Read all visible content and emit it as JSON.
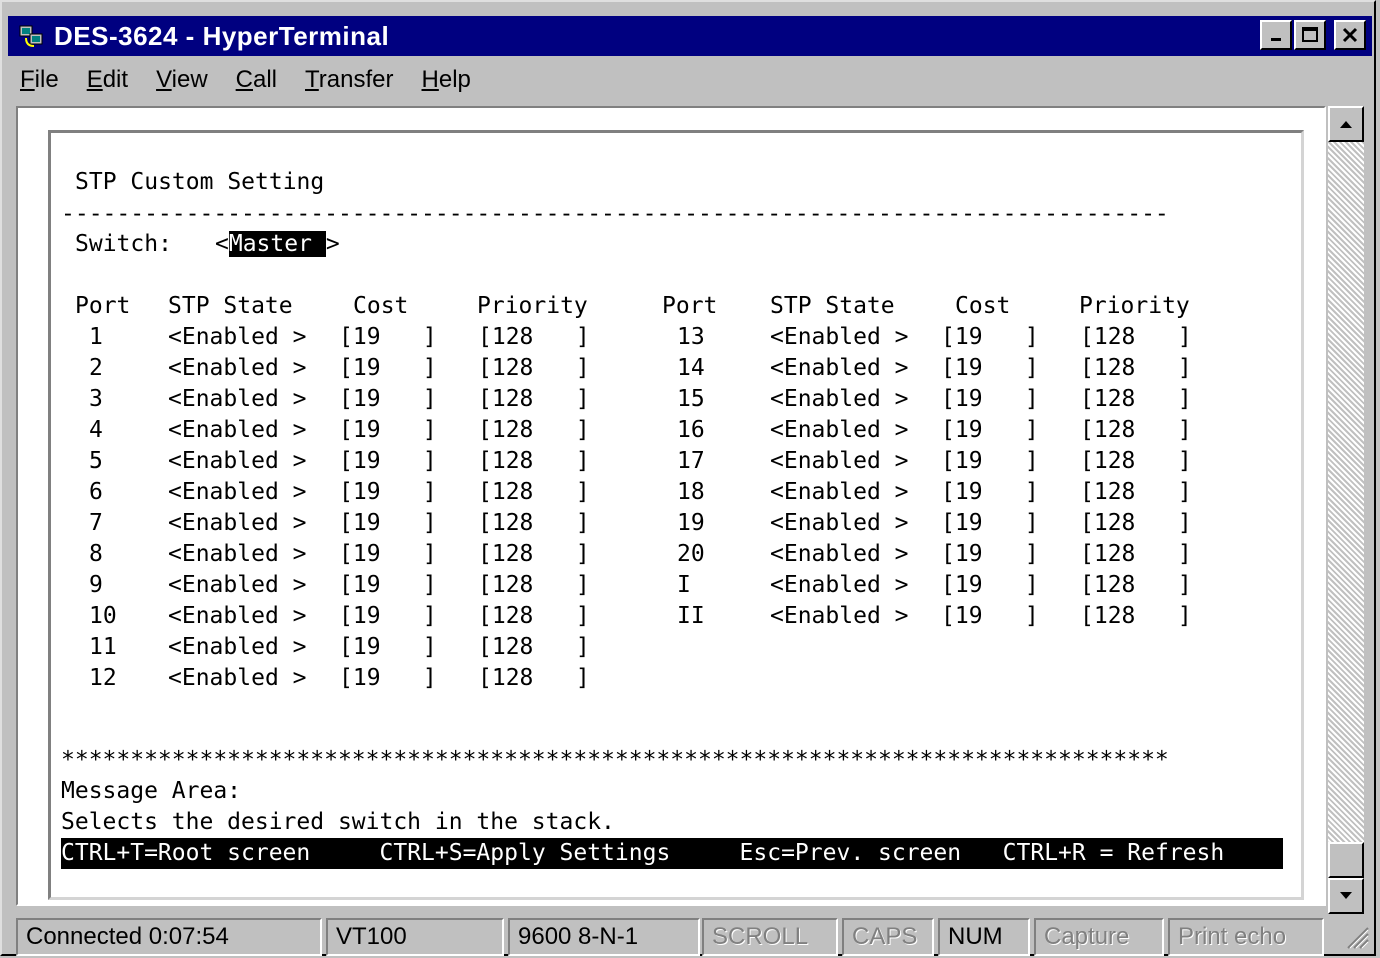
{
  "window": {
    "title": "DES-3624 - HyperTerminal"
  },
  "menu": [
    "File",
    "Edit",
    "View",
    "Call",
    "Transfer",
    "Help"
  ],
  "menu_underline": [
    "F",
    "E",
    "V",
    "C",
    "T",
    "H"
  ],
  "terminal": {
    "heading": "STP Custom Setting",
    "dash_line": "--------------------------------------------------------------------------------",
    "switch_label": "Switch:",
    "switch_value": "Master",
    "columns": [
      "Port",
      "STP State",
      "Cost",
      "Priority",
      "Port",
      "STP State",
      "Cost",
      "Priority"
    ],
    "left_rows": [
      {
        "port": "1",
        "state": "Enabled",
        "cost": "19",
        "priority": "128"
      },
      {
        "port": "2",
        "state": "Enabled",
        "cost": "19",
        "priority": "128"
      },
      {
        "port": "3",
        "state": "Enabled",
        "cost": "19",
        "priority": "128"
      },
      {
        "port": "4",
        "state": "Enabled",
        "cost": "19",
        "priority": "128"
      },
      {
        "port": "5",
        "state": "Enabled",
        "cost": "19",
        "priority": "128"
      },
      {
        "port": "6",
        "state": "Enabled",
        "cost": "19",
        "priority": "128"
      },
      {
        "port": "7",
        "state": "Enabled",
        "cost": "19",
        "priority": "128"
      },
      {
        "port": "8",
        "state": "Enabled",
        "cost": "19",
        "priority": "128"
      },
      {
        "port": "9",
        "state": "Enabled",
        "cost": "19",
        "priority": "128"
      },
      {
        "port": "10",
        "state": "Enabled",
        "cost": "19",
        "priority": "128"
      },
      {
        "port": "11",
        "state": "Enabled",
        "cost": "19",
        "priority": "128"
      },
      {
        "port": "12",
        "state": "Enabled",
        "cost": "19",
        "priority": "128"
      }
    ],
    "right_rows": [
      {
        "port": "13",
        "state": "Enabled",
        "cost": "19",
        "priority": "128"
      },
      {
        "port": "14",
        "state": "Enabled",
        "cost": "19",
        "priority": "128"
      },
      {
        "port": "15",
        "state": "Enabled",
        "cost": "19",
        "priority": "128"
      },
      {
        "port": "16",
        "state": "Enabled",
        "cost": "19",
        "priority": "128"
      },
      {
        "port": "17",
        "state": "Enabled",
        "cost": "19",
        "priority": "128"
      },
      {
        "port": "18",
        "state": "Enabled",
        "cost": "19",
        "priority": "128"
      },
      {
        "port": "19",
        "state": "Enabled",
        "cost": "19",
        "priority": "128"
      },
      {
        "port": "20",
        "state": "Enabled",
        "cost": "19",
        "priority": "128"
      },
      {
        "port": "I",
        "state": "Enabled",
        "cost": "19",
        "priority": "128"
      },
      {
        "port": "II",
        "state": "Enabled",
        "cost": "19",
        "priority": "128"
      }
    ],
    "star_line": "********************************************************************************",
    "message_label": "Message Area:",
    "message_text": "Selects the desired switch in the stack.",
    "footer_keys": [
      "CTRL+T=Root screen",
      "CTRL+S=Apply Settings",
      "Esc=Prev. screen",
      "CTRL+R = Refresh"
    ]
  },
  "status": {
    "connected": "Connected 0:07:54",
    "emulation": "VT100",
    "port_settings": "9600 8-N-1",
    "scroll": "SCROLL",
    "caps": "CAPS",
    "num": "NUM",
    "capture": "Capture",
    "print_echo": "Print echo"
  },
  "icons": {
    "app": "hyperterminal-icon",
    "minimize": "minimize-icon",
    "maximize": "maximize-icon",
    "close": "close-icon",
    "scroll_up": "arrow-up-icon",
    "scroll_down": "arrow-down-icon",
    "grip": "resize-grip-icon"
  },
  "colors": {
    "titlebar": "#000080",
    "face": "#c0c0c0",
    "terminal_bg": "#ffffff"
  }
}
